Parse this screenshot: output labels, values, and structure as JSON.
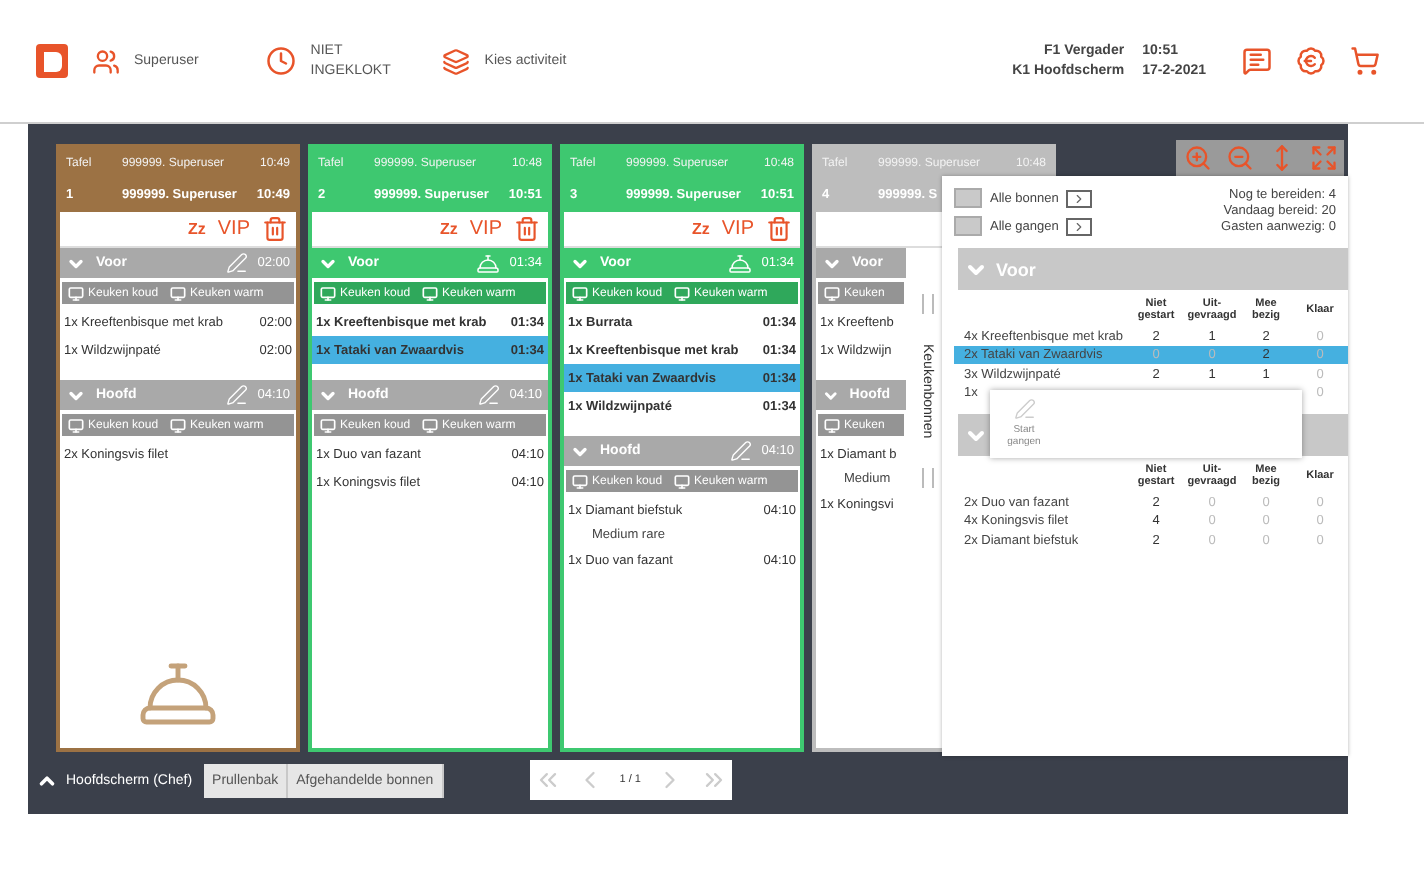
{
  "header": {
    "user": "Superuser",
    "clock_status": "NIET INGEKLOKT",
    "activity": "Kies activiteit",
    "info": [
      {
        "label": "F1 Vergader",
        "value": "10:51"
      },
      {
        "label": "K1 Hoofdscherm",
        "value": "17-2-2021"
      }
    ]
  },
  "cards": [
    {
      "kind": "ready",
      "label": "Tafel",
      "waiter": "999999. Superuser",
      "opened": "10:49",
      "number": "1",
      "waiter_current": "999999. Superuser",
      "time": "10:49",
      "snooze": "Zz",
      "vip": "VIP",
      "courses": [
        {
          "name": "Voor",
          "started": false,
          "time": "02:00",
          "stations": [
            "Keuken koud",
            "Keuken warm"
          ],
          "items": [
            {
              "text": "1x Kreeftenbisque met krab",
              "time": "02:00",
              "called": false,
              "selected": false
            },
            {
              "text": "1x Wildzwijnpaté",
              "time": "02:00",
              "called": false,
              "selected": false
            }
          ]
        },
        {
          "name": "Hoofd",
          "started": false,
          "time": "04:10",
          "stations": [
            "Keuken koud",
            "Keuken warm"
          ],
          "items": [
            {
              "text": "2x Koningsvis filet",
              "called": false,
              "selected": false
            }
          ]
        }
      ]
    },
    {
      "kind": "active",
      "label": "Tafel",
      "waiter": "999999. Superuser",
      "opened": "10:48",
      "number": "2",
      "waiter_current": "999999. Superuser",
      "time": "10:51",
      "snooze": "Zz",
      "vip": "VIP",
      "courses": [
        {
          "name": "Voor",
          "started": true,
          "time": "01:34",
          "stations": [
            "Keuken koud",
            "Keuken warm"
          ],
          "items": [
            {
              "text": "1x Kreeftenbisque met krab",
              "time": "01:34",
              "called": true,
              "selected": false
            },
            {
              "text": "1x Tataki van Zwaardvis",
              "time": "01:34",
              "called": true,
              "selected": true
            }
          ]
        },
        {
          "name": "Hoofd",
          "started": false,
          "time": "04:10",
          "stations": [
            "Keuken koud",
            "Keuken warm"
          ],
          "items": [
            {
              "text": "1x Duo van fazant",
              "time": "04:10",
              "called": false,
              "selected": false
            },
            {
              "text": "1x Koningsvis filet",
              "time": "04:10",
              "called": false,
              "selected": false
            }
          ]
        }
      ]
    },
    {
      "kind": "active",
      "label": "Tafel",
      "waiter": "999999. Superuser",
      "opened": "10:48",
      "number": "3",
      "waiter_current": "999999. Superuser",
      "time": "10:51",
      "snooze": "Zz",
      "vip": "VIP",
      "courses": [
        {
          "name": "Voor",
          "started": true,
          "time": "01:34",
          "stations": [
            "Keuken koud",
            "Keuken warm"
          ],
          "items": [
            {
              "text": "1x Burrata",
              "time": "01:34",
              "called": true,
              "selected": false
            },
            {
              "text": "1x Kreeftenbisque met krab",
              "time": "01:34",
              "called": true,
              "selected": false
            },
            {
              "text": "1x Tataki van Zwaardvis",
              "time": "01:34",
              "called": true,
              "selected": true
            },
            {
              "text": "1x Wildzwijnpaté",
              "time": "01:34",
              "called": true,
              "selected": false
            }
          ]
        },
        {
          "name": "Hoofd",
          "started": false,
          "time": "04:10",
          "stations": [
            "Keuken koud",
            "Keuken warm"
          ],
          "items": [
            {
              "text": "1x Diamant biefstuk",
              "time": "04:10",
              "note": "Medium rare",
              "called": false,
              "selected": false
            },
            {
              "text": "1x Duo van fazant",
              "time": "04:10",
              "called": false,
              "selected": false
            }
          ]
        }
      ]
    },
    {
      "kind": "waiting",
      "label": "Tafel",
      "waiter": "999999. Superuser",
      "opened": "10:48",
      "number": "4",
      "waiter_current": "999999. S",
      "courses": [
        {
          "name": "Voor",
          "started": false,
          "stations": [
            "Keuken"
          ],
          "items": [
            {
              "text": "1x Kreeftenb",
              "called": false,
              "selected": false
            },
            {
              "text": "1x Wildzwijn",
              "called": false,
              "selected": false
            }
          ]
        },
        {
          "name": "Hoofd",
          "started": false,
          "stations": [
            "Keuken"
          ],
          "items": [
            {
              "text": "1x Diamant b",
              "note": "Medium",
              "called": false,
              "selected": false
            },
            {
              "text": "1x Koningsvi",
              "called": false,
              "selected": false
            }
          ]
        }
      ]
    }
  ],
  "kitchen_panel": {
    "tab_label": "Keukenbonnen",
    "filters": [
      {
        "label": "Alle bonnen",
        "checked": false
      },
      {
        "label": "Alle gangen",
        "checked": false
      }
    ],
    "stats": [
      "Nog te bereiden: 4",
      "Vandaag bereid: 20",
      "Gasten aanwezig: 0"
    ],
    "courses": [
      {
        "name": "Voor",
        "columns": [
          "Niet gestart",
          "Uit-gevraagd",
          "Mee bezig",
          "Klaar"
        ],
        "rows": [
          {
            "item": "4x Kreeftenbisque met krab",
            "selected": false,
            "counts": [
              {
                "value": "2",
                "dim": false
              },
              {
                "value": "1",
                "dim": false
              },
              {
                "value": "2",
                "dim": false
              },
              {
                "value": "0",
                "dim": true
              }
            ]
          },
          {
            "item": "2x Tataki van Zwaardvis",
            "selected": true,
            "counts": [
              {
                "value": "0",
                "dim": true
              },
              {
                "value": "0",
                "dim": true
              },
              {
                "value": "2",
                "dim": false
              },
              {
                "value": "0",
                "dim": true
              }
            ]
          },
          {
            "item": "3x Wildzwijnpaté",
            "selected": false,
            "counts": [
              {
                "value": "2",
                "dim": false
              },
              {
                "value": "1",
                "dim": false
              },
              {
                "value": "1",
                "dim": false
              },
              {
                "value": "0",
                "dim": true
              }
            ]
          },
          {
            "item": "1x",
            "selected": false,
            "counts": [
              {
                "value": "0",
                "dim": true
              }
            ]
          }
        ]
      },
      {
        "columns": [
          "Niet gestart",
          "Uit-gevraagd",
          "Mee bezig",
          "Klaar"
        ],
        "rows": [
          {
            "item": "2x Duo van fazant",
            "selected": false,
            "counts": [
              {
                "value": "2",
                "dim": false
              },
              {
                "value": "0",
                "dim": true
              },
              {
                "value": "0",
                "dim": true
              },
              {
                "value": "0",
                "dim": true
              }
            ]
          },
          {
            "item": "4x Koningsvis filet",
            "selected": false,
            "counts": [
              {
                "value": "4",
                "dim": false
              },
              {
                "value": "0",
                "dim": true
              },
              {
                "value": "0",
                "dim": true
              },
              {
                "value": "0",
                "dim": true
              }
            ]
          },
          {
            "item": "2x Diamant biefstuk",
            "selected": false,
            "counts": [
              {
                "value": "2",
                "dim": false
              },
              {
                "value": "0",
                "dim": true
              },
              {
                "value": "0",
                "dim": true
              },
              {
                "value": "0",
                "dim": true
              }
            ]
          }
        ]
      }
    ],
    "popup": {
      "label": "Start gangen"
    }
  },
  "bottom_bar": {
    "screen": "Hoofdscherm (Chef)",
    "buttons": [
      "Prullenbak",
      "Afgehandelde bonnen"
    ],
    "pager": "1 / 1"
  }
}
